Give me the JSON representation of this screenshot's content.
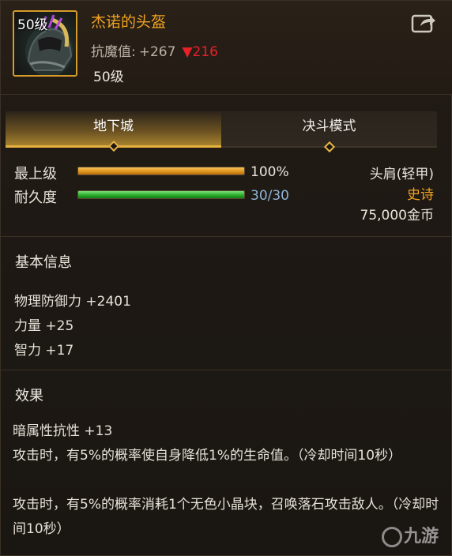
{
  "item": {
    "level_badge": "50级",
    "name": "杰诺的头盔",
    "resistance_label": "抗魔值:",
    "resistance_value": "+267",
    "resistance_change": "▼216",
    "level_text": "50级"
  },
  "tabs": [
    {
      "label": "地下城",
      "active": true
    },
    {
      "label": "决斗模式",
      "active": false
    }
  ],
  "bars": {
    "grade": {
      "label": "最上级",
      "value_text": "100%",
      "fraction": 1.0
    },
    "durability": {
      "label": "耐久度",
      "value_text": "30/30",
      "fraction": 1.0
    }
  },
  "meta": {
    "slot": "头肩(轻甲)",
    "rarity": "史诗",
    "price": "75,000金币"
  },
  "basic_info": {
    "title": "基本信息",
    "stats": [
      "物理防御力 +2401",
      "力量 +25",
      "智力 +17"
    ]
  },
  "effects": {
    "title": "效果",
    "lines": [
      "暗属性抗性 +13",
      "攻击时，有5%的概率使自身降低1%的生命值。（冷却时间10秒）",
      "攻击时，有5%的概率消耗1个无色小晶块，召唤落石攻击敌人。（冷却时间10秒）"
    ]
  },
  "watermark": "九游",
  "colors": {
    "name": "#f0a322",
    "rarity": "#f0a322",
    "decrease": "#e8202a",
    "durability_text": "#8fb3d6",
    "accent": "#e5b13e"
  },
  "icons": [
    "helmet-icon",
    "share-icon",
    "tab-diamond-icon"
  ]
}
